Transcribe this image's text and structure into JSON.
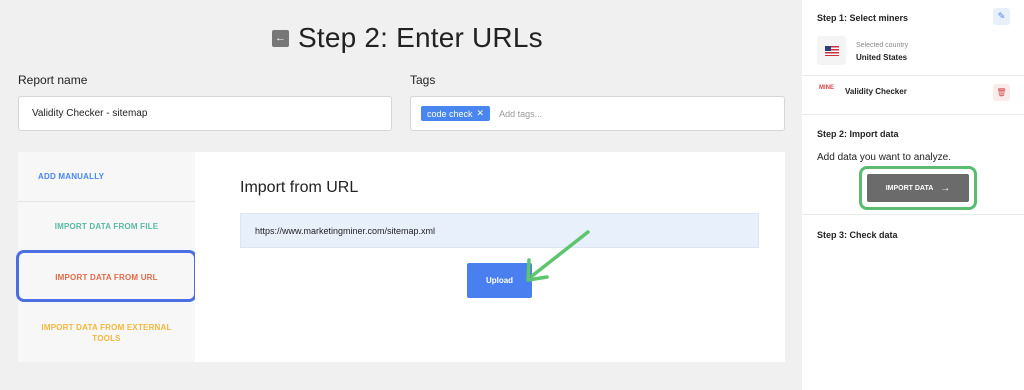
{
  "page": {
    "title": "Step 2: Enter URLs",
    "back_icon": "←"
  },
  "form": {
    "report_name_label": "Report name",
    "report_name_value": "Validity Checker - sitemap",
    "tags_label": "Tags",
    "tag_chip": "code check",
    "tag_remove": "✕",
    "tags_placeholder": "Add tags..."
  },
  "sidebar": {
    "items": [
      {
        "label": "ADD MANUALLY"
      },
      {
        "label": "IMPORT DATA FROM FILE"
      },
      {
        "label": "IMPORT DATA FROM URL"
      },
      {
        "label": "IMPORT DATA FROM EXTERNAL TOOLS"
      }
    ]
  },
  "content": {
    "heading": "Import from URL",
    "url_value": "https://www.marketingminer.com/sitemap.xml",
    "upload_label": "Upload"
  },
  "right_panel": {
    "step1_title": "Step 1: Select miners",
    "edit_icon": "✎",
    "country_label": "Selected country",
    "country_value": "United States",
    "miner_icon_text": "MINE",
    "miner_label": "Validity Checker",
    "trash_icon": "🗑",
    "step2_title": "Step 2: Import data",
    "step2_desc": "Add data you want to analyze.",
    "import_button": "IMPORT DATA",
    "import_arrow": "→",
    "step3_title": "Step 3: Check data"
  },
  "colors": {
    "accent_blue": "#4a7ff0",
    "highlight_blue": "#4b6fe3",
    "highlight_green": "#5dbb6f",
    "annotation_arrow": "#5ec46e"
  }
}
